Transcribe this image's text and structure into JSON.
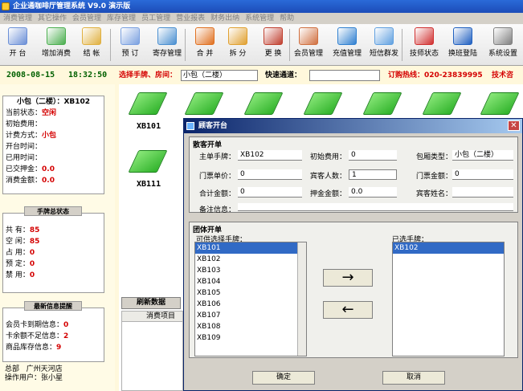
{
  "window": {
    "title": "企业通咖啡厅管理系统 V9.0  演示版"
  },
  "menu": [
    "消费管理",
    "其它操作",
    "会员管理",
    "库存管理",
    "员工管理",
    "营业报表",
    "财务出纳",
    "系统管理",
    "帮助"
  ],
  "toolbar": [
    {
      "label": "开 台",
      "icon": "table-icon",
      "color": "#6b8fd6"
    },
    {
      "label": "增加消费",
      "icon": "add-consume-icon",
      "color": "#4caf50"
    },
    {
      "label": "结 帐",
      "icon": "checkout-icon",
      "color": "#e0b040"
    },
    {
      "label": "预 订",
      "icon": "reserve-icon",
      "color": "#7aa0e0"
    },
    {
      "label": "寄存管理",
      "icon": "storage-icon",
      "color": "#4a8fd0"
    },
    {
      "label": "合 并",
      "icon": "merge-icon",
      "color": "#e07020"
    },
    {
      "label": "拆 分",
      "icon": "split-icon",
      "color": "#e0a030"
    },
    {
      "label": "更 换",
      "icon": "change-icon",
      "color": "#c04030"
    },
    {
      "label": "会员管理",
      "icon": "members-icon",
      "color": "#d07040"
    },
    {
      "label": "充值管理",
      "icon": "recharge-icon",
      "color": "#3080d0"
    },
    {
      "label": "短信群发",
      "icon": "sms-icon",
      "color": "#60a0e0"
    },
    {
      "label": "技师状态",
      "icon": "technician-icon",
      "color": "#d03030"
    },
    {
      "label": "换班登陆",
      "icon": "shift-login-icon",
      "color": "#2060c0"
    },
    {
      "label": "系统设置",
      "icon": "settings-icon",
      "color": "#808080"
    }
  ],
  "status": {
    "date": "2008-08-15",
    "time": "18:32:50",
    "select_label": "选择手牌、房间：",
    "select_value": "小包（二楼）",
    "quick_label": "快速通道：",
    "quick_value": "",
    "hotline": "订购热线：020-23839995",
    "support": "技术咨"
  },
  "room_info": {
    "header": "小包（二楼）：XB102",
    "rows": [
      {
        "k": "当前状态：",
        "v": "空闲"
      },
      {
        "k": "初始费用：",
        "v": ""
      },
      {
        "k": "计费方式：",
        "v": "小包"
      },
      {
        "k": "开台时间：",
        "v": ""
      },
      {
        "k": "已用时间：",
        "v": ""
      },
      {
        "k": "已交押金：",
        "v": "0.0"
      },
      {
        "k": "消费金额：",
        "v": "0.0"
      }
    ]
  },
  "plate_status": {
    "title": "手牌总状态",
    "rows": [
      {
        "k": "共    有：",
        "v": "85"
      },
      {
        "k": "空    闲：",
        "v": "85"
      },
      {
        "k": "占    用：",
        "v": "0"
      },
      {
        "k": "预    定：",
        "v": "0"
      },
      {
        "k": "禁    用：",
        "v": "0"
      }
    ]
  },
  "alerts": {
    "title": "最新信息提醒",
    "rows": [
      {
        "k": "会员卡到期信息：",
        "v": "0"
      },
      {
        "k": "卡余额不足信息：",
        "v": "2"
      },
      {
        "k": "商品库存信息：",
        "v": "9"
      }
    ],
    "branch_label": "总部",
    "branch_value": "广州天河店",
    "operator_label": "操作用户：",
    "operator_value": "张小星"
  },
  "tables": {
    "labels": [
      "XB101",
      "XB111"
    ]
  },
  "refresh": {
    "button": "刷新数据",
    "col": "消费项目"
  },
  "dialog": {
    "title": "顾客开台",
    "scatter": {
      "title": "散客开单",
      "host_plate_label": "主单手牌：",
      "host_plate": "XB102",
      "init_fee_label": "初始费用：",
      "init_fee": "0",
      "room_type_label": "包厢类型：",
      "room_type": "小包（二楼）",
      "ticket_price_label": "门票单价：",
      "ticket_price": "0",
      "guests_label": "宾客人数：",
      "guests": "1",
      "ticket_amount_label": "门票金额：",
      "ticket_amount": "0",
      "total_label": "合计金额：",
      "total": "0",
      "deposit_label": "押金金额：",
      "deposit": "0.0",
      "guest_name_label": "宾客姓名：",
      "guest_name": "",
      "remark_label": "备注信息：",
      "remark": ""
    },
    "group": {
      "title": "团体开单",
      "available_label": "可供选择手牌：",
      "available": [
        "XB101",
        "XB102",
        "XB103",
        "XB104",
        "XB105",
        "XB106",
        "XB107",
        "XB108",
        "XB109"
      ],
      "selected_label": "已选手牌：",
      "selected": [
        "XB102"
      ],
      "add_arrow": "→",
      "remove_arrow": "←"
    },
    "ok": "确定",
    "cancel": "取消"
  }
}
